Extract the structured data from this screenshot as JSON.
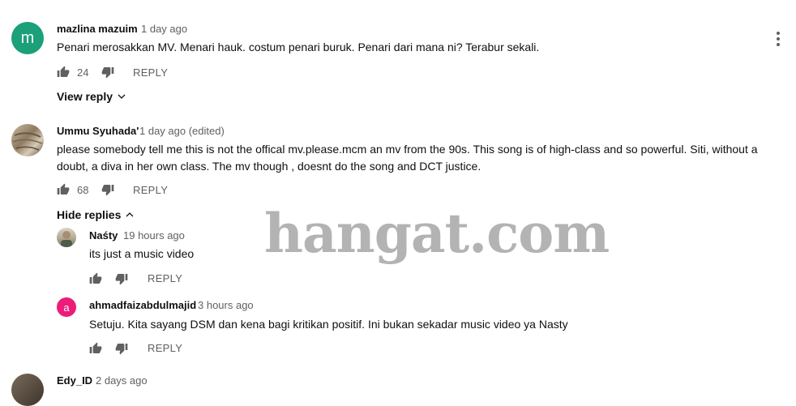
{
  "comments": [
    {
      "author": "mazlina mazuim",
      "time": "1 day ago",
      "avatar_letter": "m",
      "avatar_color": "#1ba079",
      "text": "Penari merosakkan MV. Menari hauk. costum penari buruk. Penari dari mana ni? Terabur sekali.",
      "likes": "24",
      "reply_label": "REPLY",
      "toggle_label": "View reply"
    },
    {
      "author": "Ummu Syuhada'",
      "time": "1 day ago (edited)",
      "text": "please somebody tell me this is not the offical mv.please.mcm an mv from the 90s. This song is of high-class and so powerful. Siti, without a doubt, a diva in her own class. The mv though , doesnt do the song and DCT justice.",
      "likes": "68",
      "reply_label": "REPLY",
      "toggle_label": "Hide replies",
      "replies": [
        {
          "author": "Naśty",
          "time": "19 hours ago",
          "text": "its just a music video",
          "reply_label": "REPLY"
        },
        {
          "author": "ahmadfaizabdulmajid",
          "time": "3 hours ago",
          "avatar_letter": "a",
          "avatar_color": "#ec1c79",
          "text": "Setuju. Kita sayang DSM dan kena bagi kritikan positif. Ini bukan sekadar music video ya Nasty",
          "reply_label": "REPLY"
        }
      ]
    },
    {
      "author": "Edy_ID",
      "time": "2 days ago"
    }
  ],
  "watermark": {
    "text": "hangat.com"
  },
  "colors": {
    "secondary_text": "#606060",
    "primary_text": "#0f0f0f"
  }
}
